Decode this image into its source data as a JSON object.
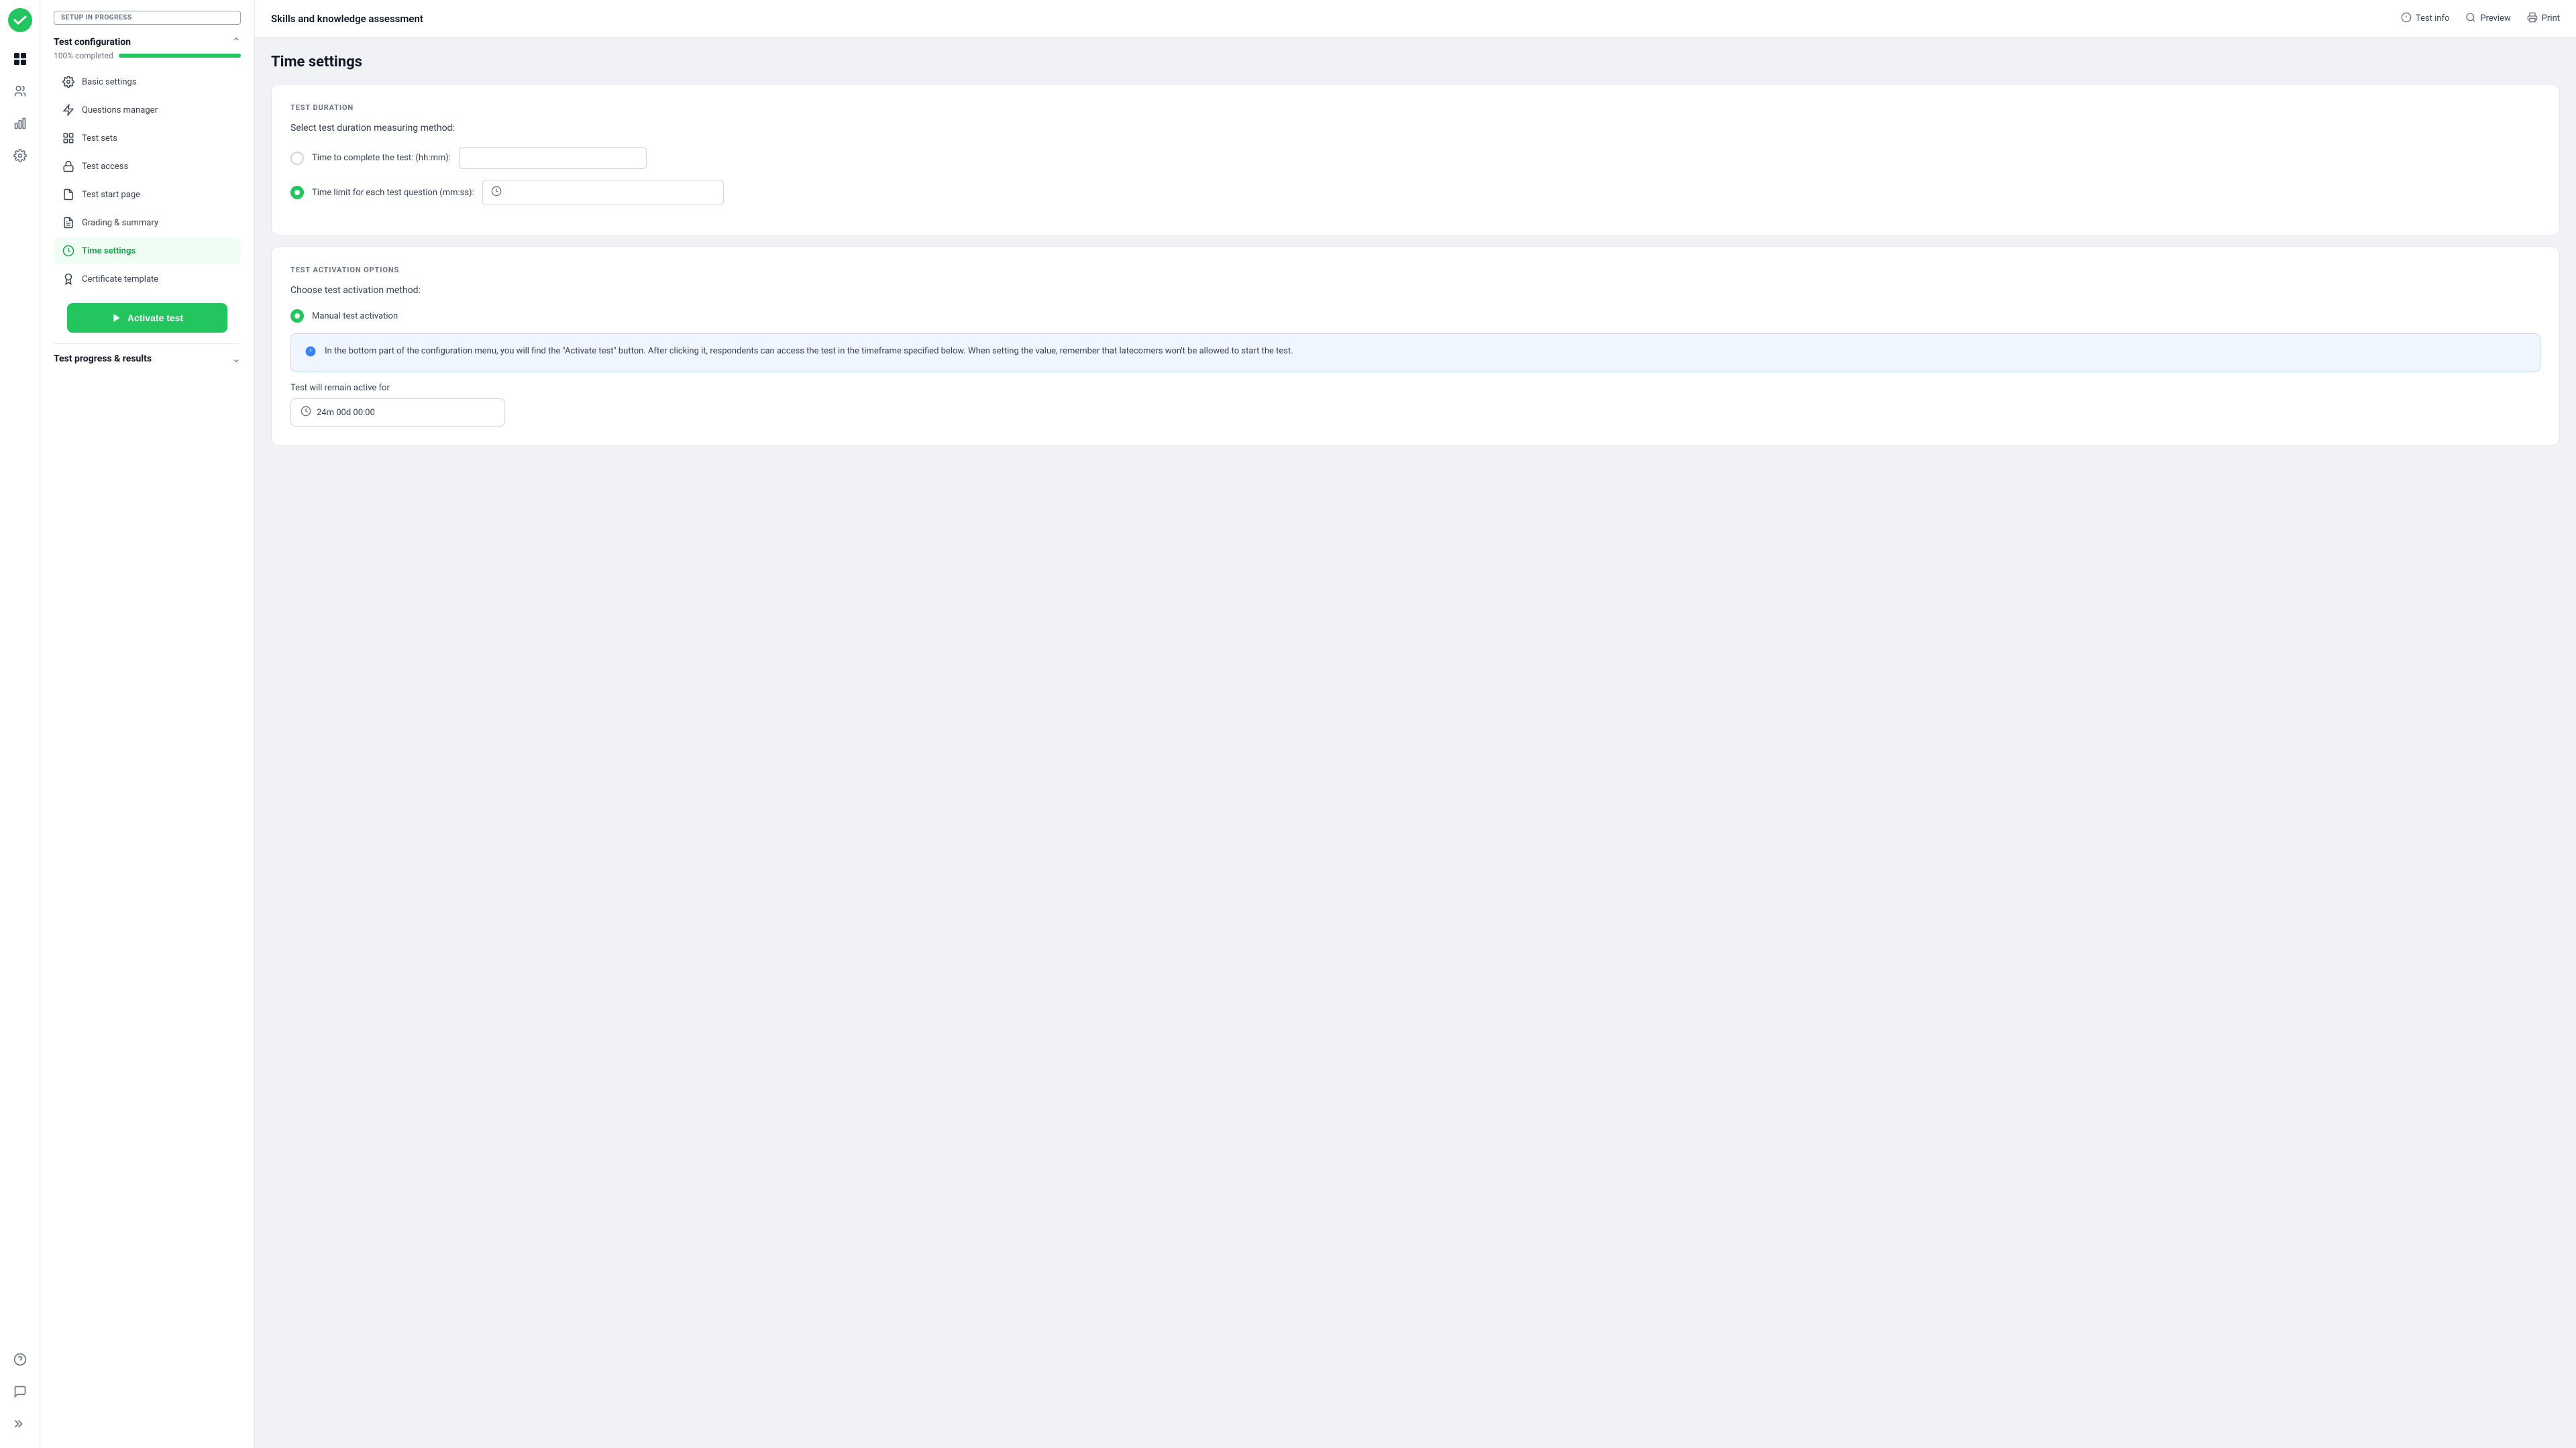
{
  "app": {
    "title": "Skills and knowledge assessment"
  },
  "top_bar": {
    "title": "Skills and knowledge assessment",
    "actions": [
      {
        "id": "test-info",
        "label": "Test info",
        "icon": "ℹ️"
      },
      {
        "id": "preview",
        "label": "Preview",
        "icon": "👁"
      },
      {
        "id": "print",
        "label": "Print",
        "icon": "🖨"
      }
    ]
  },
  "sidebar": {
    "setup_badge": "SETUP IN PROGRESS",
    "config_section": {
      "title": "Test configuration",
      "progress_label": "100% completed",
      "progress_percent": 100,
      "menu_items": [
        {
          "id": "basic-settings",
          "label": "Basic settings",
          "icon": "⚙️",
          "active": false
        },
        {
          "id": "questions-manager",
          "label": "Questions manager",
          "icon": "⚡",
          "active": false
        },
        {
          "id": "test-sets",
          "label": "Test sets",
          "icon": "▦",
          "active": false
        },
        {
          "id": "test-access",
          "label": "Test access",
          "icon": "🔒",
          "active": false
        },
        {
          "id": "test-start-page",
          "label": "Test start page",
          "icon": "📄",
          "active": false
        },
        {
          "id": "grading-summary",
          "label": "Grading & summary",
          "icon": "📋",
          "active": false
        },
        {
          "id": "time-settings",
          "label": "Time settings",
          "icon": "🕐",
          "active": true
        },
        {
          "id": "certificate-template",
          "label": "Certificate template",
          "icon": "🏅",
          "active": false
        }
      ],
      "activate_button": "Activate test"
    },
    "results_section": {
      "title": "Test progress & results"
    }
  },
  "content": {
    "page_title": "Time settings",
    "test_duration_card": {
      "section_label": "TEST DURATION",
      "subtitle": "Select test duration measuring method:",
      "option1_label": "Time to complete the test: (hh:mm):",
      "option1_selected": false,
      "option1_value": "",
      "option2_label": "Time limit for each test question (mm:ss):",
      "option2_selected": true,
      "option2_value": ""
    },
    "test_activation_card": {
      "section_label": "TEST ACTIVATION OPTIONS",
      "subtitle": "Choose test activation method:",
      "option1_label": "Manual test activation",
      "option1_selected": true,
      "info_text": "In the bottom part of the configuration menu, you will find the \"Activate test\" button. After clicking it, respondents can access the test in the timeframe specified below. When setting the value, remember that latecomers won't be allowed to start the test.",
      "duration_label": "Test will remain active for",
      "duration_value": "24m 00d 00:00"
    }
  }
}
